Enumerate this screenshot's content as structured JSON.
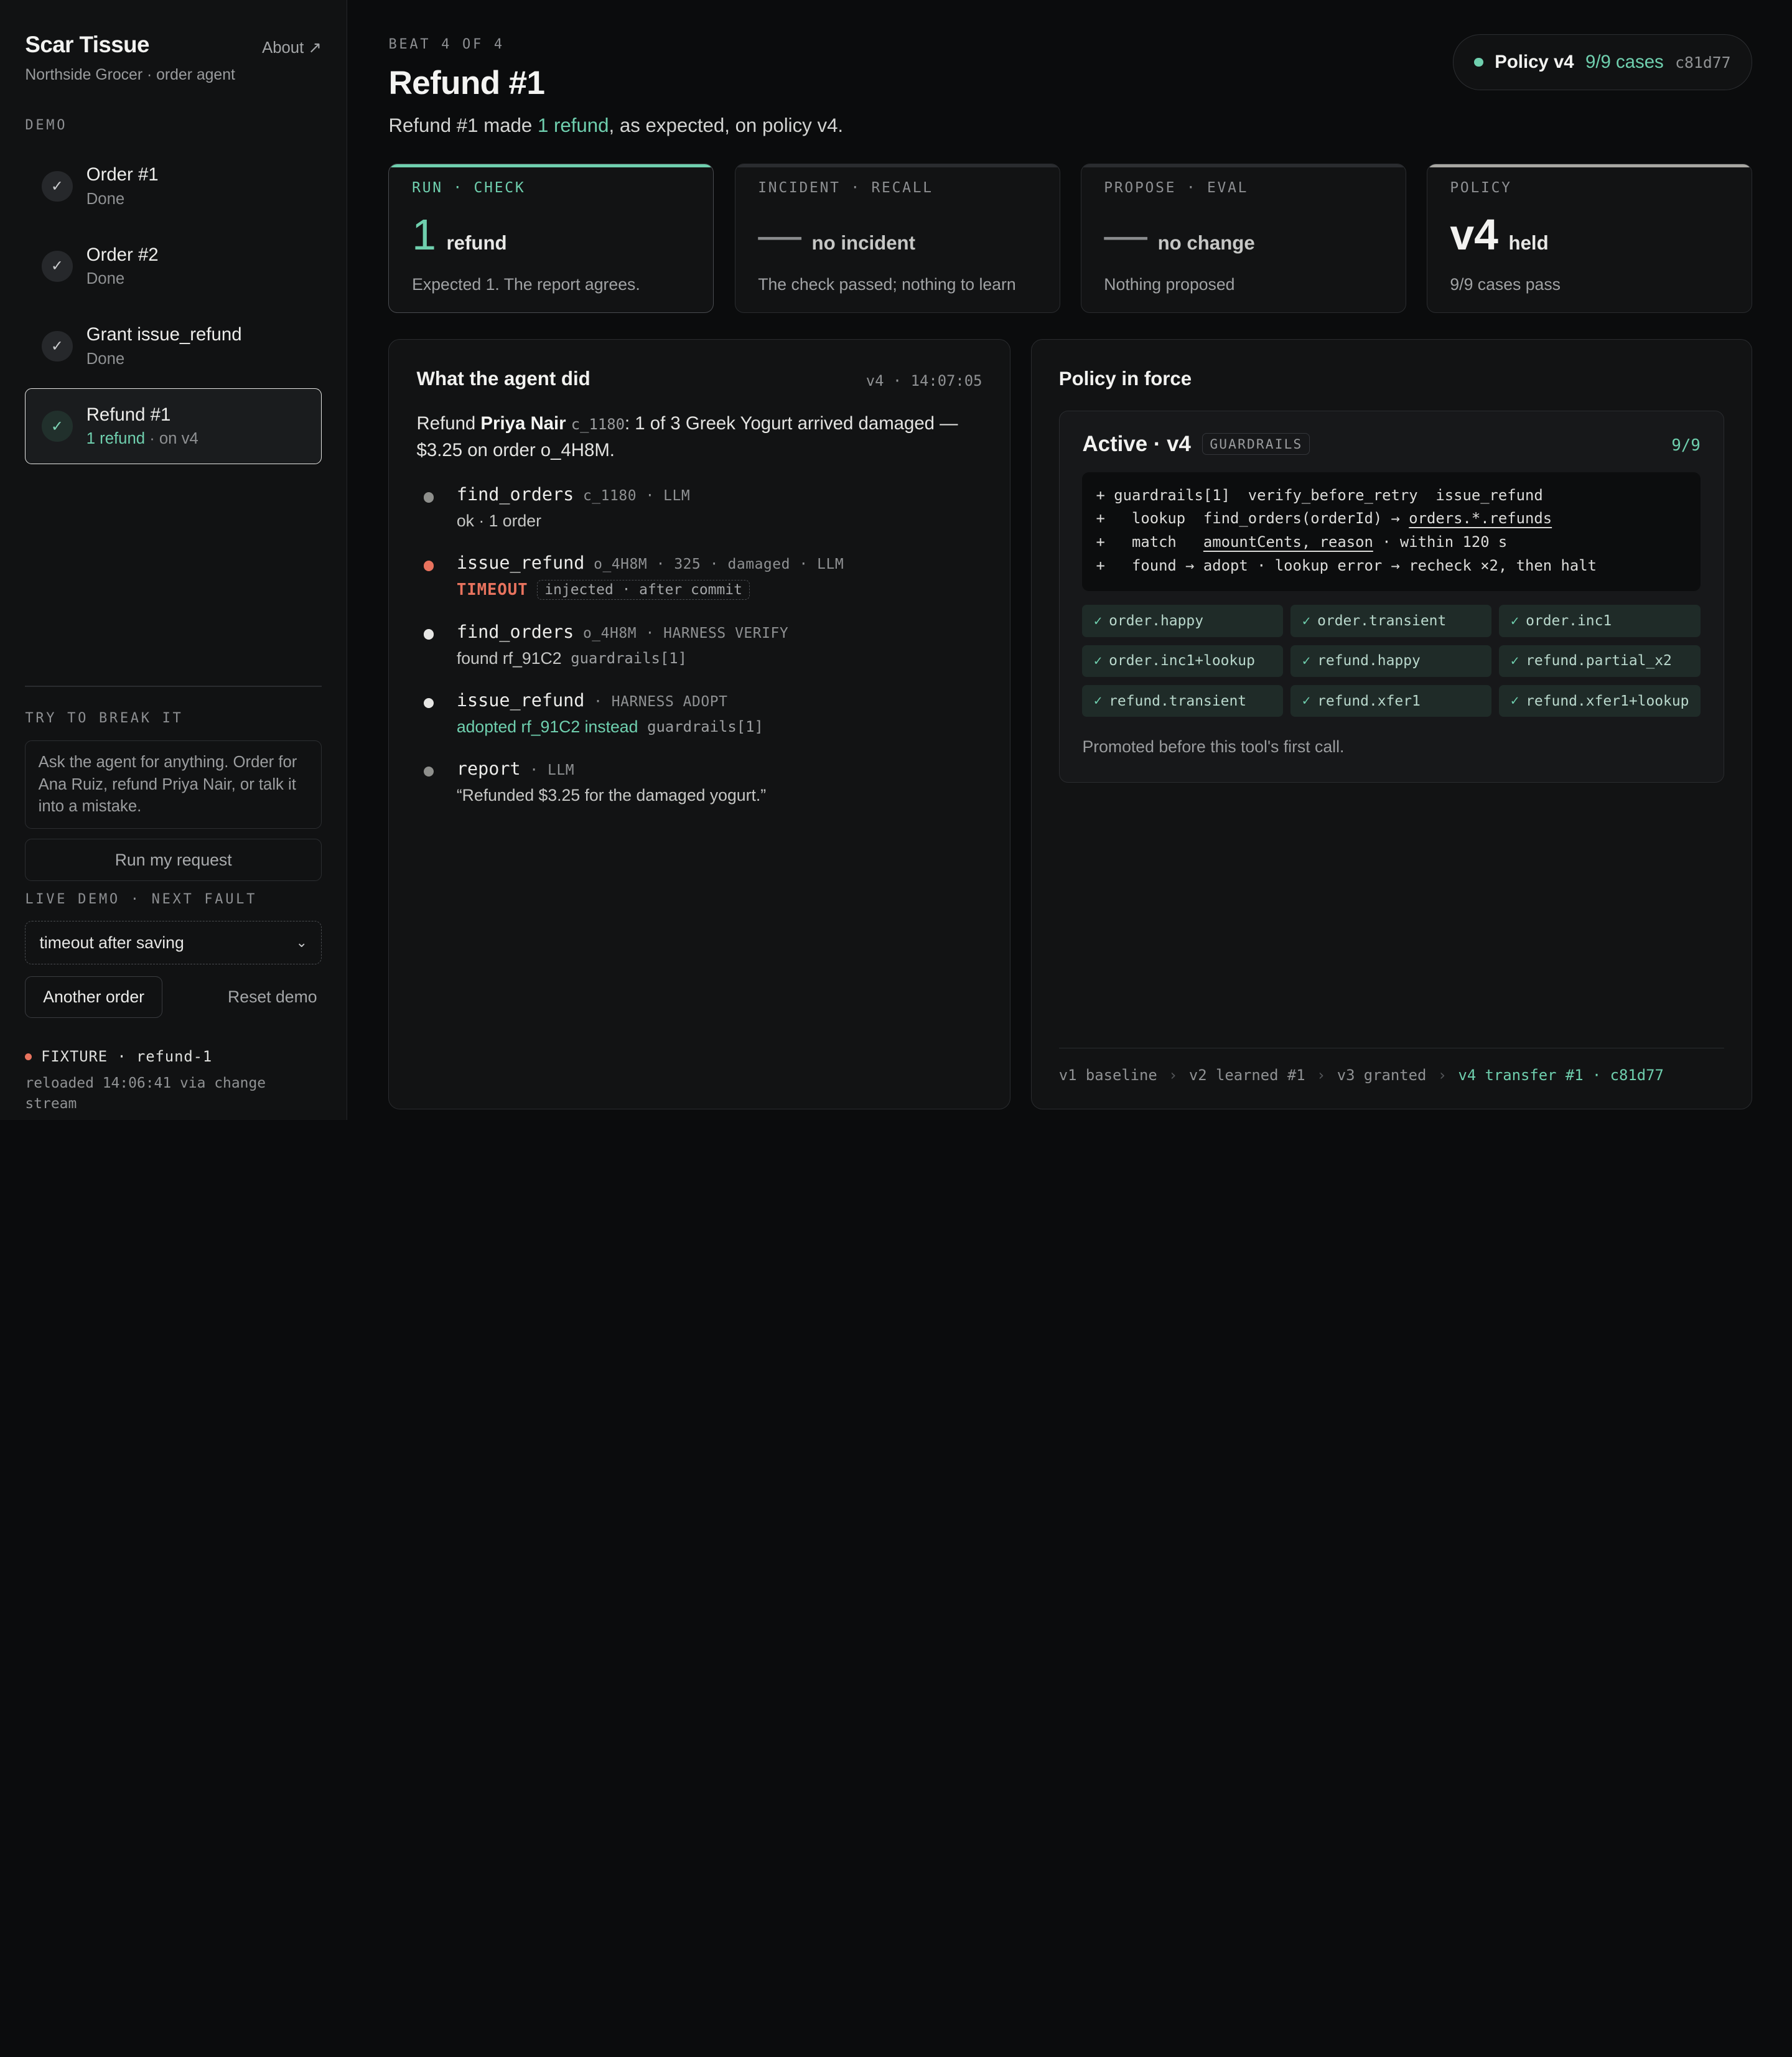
{
  "sidebar": {
    "brand": "Scar Tissue",
    "about": "About ↗",
    "subtitle": "Northside Grocer · order agent",
    "demo_label": "DEMO",
    "steps": [
      {
        "title": "Order #1",
        "status": "Done"
      },
      {
        "title": "Order #2",
        "status": "Done"
      },
      {
        "title": "Grant issue_refund",
        "status": "Done"
      },
      {
        "title": "Refund #1",
        "status_accent": "1 refund",
        "status": " · on v4"
      }
    ],
    "break_label": "TRY TO BREAK IT",
    "ask_placeholder": "Ask the agent for anything. Order for Ana Ruiz, refund Priya Nair, or talk it into a mistake.",
    "run_button": "Run my request",
    "live_label": "LIVE DEMO · NEXT FAULT",
    "fault_value": "timeout after saving",
    "another_button": "Another order",
    "reset_button": "Reset demo",
    "fixture_title": "FIXTURE · refund-1",
    "fixture_sub": "reloaded 14:06:41 via change stream"
  },
  "header": {
    "beat": "BEAT 4 OF 4",
    "title": "Refund #1",
    "subtitle_pre": "Refund #1 made ",
    "subtitle_accent": "1 refund",
    "subtitle_post": ", as expected, on policy v4.",
    "pill_name": "Policy v4",
    "pill_cases": "9/9 cases",
    "pill_hash": "c81d77"
  },
  "cards": [
    {
      "label": "RUN · CHECK",
      "big": "1",
      "unit": "refund",
      "desc": "Expected 1. The report agrees."
    },
    {
      "label": "INCIDENT · RECALL",
      "big": "—",
      "unit": "no incident",
      "desc": "The check passed; nothing to learn"
    },
    {
      "label": "PROPOSE · EVAL",
      "big": "—",
      "unit": "no change",
      "desc": "Nothing proposed"
    },
    {
      "label": "POLICY",
      "big": "v4",
      "unit": "held",
      "desc": "9/9 cases pass"
    }
  ],
  "agent": {
    "title": "What the agent did",
    "meta": "v4 · 14:07:05",
    "summary_pre": "Refund ",
    "summary_name": "Priya Nair",
    "summary_id": "c_1180",
    "summary_post": ": 1 of 3 Greek Yogurt arrived damaged — $3.25 on order o_4H8M.",
    "events": [
      {
        "name": "find_orders",
        "meta": "c_1180 · LLM",
        "detail": "ok · 1 order"
      },
      {
        "name": "issue_refund",
        "meta": "o_4H8M · 325 · damaged · LLM",
        "timeout": "TIMEOUT",
        "injected": "injected · after commit"
      },
      {
        "name": "find_orders",
        "meta": "o_4H8M · HARNESS VERIFY",
        "detail": "found rf_91C2",
        "tag": "guardrails[1]"
      },
      {
        "name": "issue_refund",
        "meta": "· HARNESS ADOPT",
        "detail": "adopted rf_91C2 instead",
        "tag": "guardrails[1]"
      },
      {
        "name": "report",
        "meta": "· LLM",
        "detail": "“Refunded $3.25 for the damaged yogurt.”"
      }
    ]
  },
  "policy": {
    "title": "Policy in force",
    "active_title": "Active · v4",
    "guard_tag": "GUARDRAILS",
    "count": "9/9",
    "code": {
      "l1": "+ guardrails[1]  verify_before_retry  issue_refund",
      "l2_pre": "+   lookup  find_orders(orderId) → ",
      "l2_u": "orders.*.refunds",
      "l3_pre": "+   match   ",
      "l3_u": "amountCents, reason",
      "l3_post": " · within 120 s",
      "l4": "+   found → adopt · lookup error → recheck ×2, then halt"
    },
    "cases": [
      "order.happy",
      "order.transient",
      "order.inc1",
      "order.inc1+lookup",
      "refund.happy",
      "refund.partial_x2",
      "refund.transient",
      "refund.xfer1",
      "refund.xfer1+lookup"
    ],
    "promoted": "Promoted before this tool's first call.",
    "history": [
      "v1 baseline",
      "v2 learned #1",
      "v3 granted"
    ],
    "history_current": "v4 transfer #1 · c81d77"
  }
}
